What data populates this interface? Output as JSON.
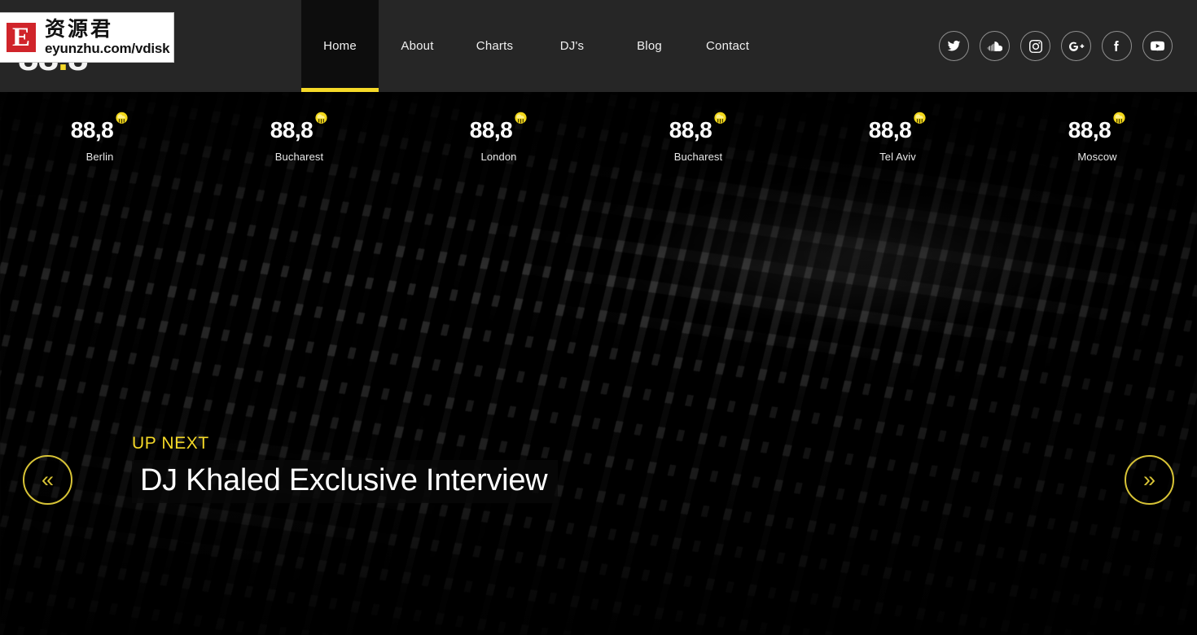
{
  "brand": {
    "logo_text": "88.8",
    "logo_accent_char": "."
  },
  "watermark": {
    "badge_letter": "E",
    "chinese_text": "资源君",
    "url_text": "eyunzhu.com/vdisk"
  },
  "nav": {
    "items": [
      {
        "label": "Home",
        "active": true
      },
      {
        "label": "About",
        "active": false
      },
      {
        "label": "Charts",
        "active": false
      },
      {
        "label": "DJ's",
        "active": false
      },
      {
        "label": "Blog",
        "active": false
      },
      {
        "label": "Contact",
        "active": false
      }
    ]
  },
  "social": {
    "items": [
      {
        "name": "twitter-icon",
        "label": "Twitter"
      },
      {
        "name": "soundcloud-icon",
        "label": "SoundCloud"
      },
      {
        "name": "instagram-icon",
        "label": "Instagram"
      },
      {
        "name": "googleplus-icon",
        "label": "Google Plus"
      },
      {
        "name": "facebook-icon",
        "label": "Facebook"
      },
      {
        "name": "youtube-icon",
        "label": "YouTube"
      }
    ]
  },
  "ticker": {
    "stations": [
      {
        "frequency": "88,8",
        "city": "Berlin",
        "weather": "rain-icon"
      },
      {
        "frequency": "88,8",
        "city": "Bucharest",
        "weather": "rain-icon"
      },
      {
        "frequency": "88,8",
        "city": "London",
        "weather": "rain-icon"
      },
      {
        "frequency": "88,8",
        "city": "Bucharest",
        "weather": "rain-icon"
      },
      {
        "frequency": "88,8",
        "city": "Tel Aviv",
        "weather": "rain-icon"
      },
      {
        "frequency": "88,8",
        "city": "Moscow",
        "weather": "rain-icon"
      }
    ]
  },
  "hero": {
    "eyebrow": "UP NEXT",
    "title": "DJ Khaled Exclusive Interview",
    "prev_label": "«",
    "next_label": "»"
  },
  "colors": {
    "accent_yellow": "#f5d928",
    "arrow_yellow": "#d7c336",
    "header_bg": "#262626",
    "active_tab_bg": "#0d0d0d",
    "watermark_red": "#d0242a"
  }
}
